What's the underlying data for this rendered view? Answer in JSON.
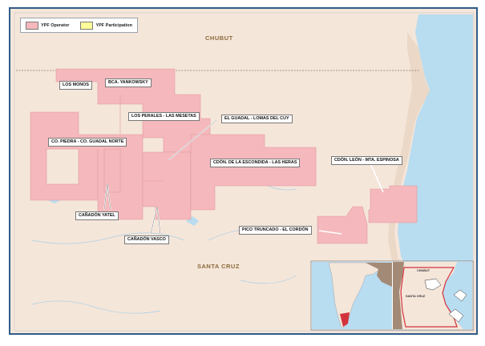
{
  "legend": {
    "items": [
      {
        "label": "YPF Operator",
        "color": "#f5b8bc"
      },
      {
        "label": "YPF Participation",
        "color": "#ffff99"
      }
    ]
  },
  "regions": {
    "north": "CHUBUT",
    "south": "SANTA CRUZ"
  },
  "areas": [
    {
      "key": "los_monos",
      "label": "LOS MONOS"
    },
    {
      "key": "bca_yankowsky",
      "label": "BCA. YANKOWSKY"
    },
    {
      "key": "los_perales",
      "label": "LOS PERALES - LAS MESETAS"
    },
    {
      "key": "el_guadal",
      "label": "EL GUADAL - LOMAS DEL CUY"
    },
    {
      "key": "co_piedra",
      "label": "CO. PIEDRA - CO. GUADAL NORTE"
    },
    {
      "key": "cdon_escondida",
      "label": "CDÓN. DE LA ESCONDIDA - LAS HERAS"
    },
    {
      "key": "cdon_leon",
      "label": "CDÓN. LEÓN - MTA. ESPINOSA"
    },
    {
      "key": "canadon_yatel",
      "label": "CAÑADÓN YATEL"
    },
    {
      "key": "canadon_vasco",
      "label": "CAÑADÓN VASCO"
    },
    {
      "key": "pico_truncado",
      "label": "PICO TRUNCADO - EL CORDÓN"
    }
  ],
  "inset": {
    "chubut_label": "CHUBUT",
    "santa_cruz_label": "SANTA CRUZ"
  },
  "colors": {
    "land": "#f5e6da",
    "sea": "#b8dcf0",
    "operator": "#f5b8bc",
    "participation": "#ffff99",
    "frame": "#2f5c8a"
  }
}
